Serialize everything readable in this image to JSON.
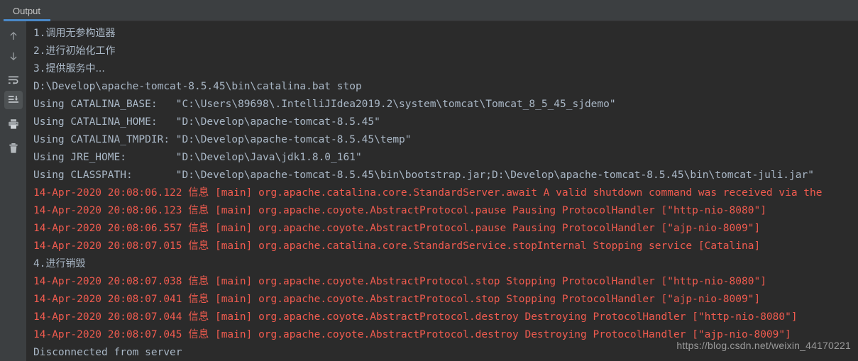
{
  "tabs": [
    {
      "label": "Output",
      "active": true
    }
  ],
  "toolbar": {
    "buttons": [
      {
        "name": "up-arrow-icon",
        "tooltip": "Up",
        "selected": false
      },
      {
        "name": "down-arrow-icon",
        "tooltip": "Down",
        "selected": false
      },
      {
        "name": "soft-wrap-icon",
        "tooltip": "Soft-Wrap",
        "selected": false
      },
      {
        "name": "scroll-to-end-icon",
        "tooltip": "Scroll to End",
        "selected": true
      },
      {
        "name": "print-icon",
        "tooltip": "Print",
        "selected": false
      },
      {
        "name": "trash-icon",
        "tooltip": "Clear All",
        "selected": false
      }
    ]
  },
  "colors": {
    "tab_underline": "#4a88c7",
    "toolbar_bg": "#3c3f41",
    "console_bg": "#2b2b2b",
    "normal_text": "#a9b7c6",
    "error_text": "#f05b4f",
    "selected_btn_bg": "#4e5254"
  },
  "console": {
    "lines": [
      {
        "type": "cn",
        "num": "1.",
        "text": "调用无参构造器"
      },
      {
        "type": "cn",
        "num": "2.",
        "text": "进行初始化工作"
      },
      {
        "type": "cn",
        "num": "3.",
        "text": "提供服务中...",
        "mono_tail": "..."
      },
      {
        "type": "sys",
        "text": "D:\\Develop\\apache-tomcat-8.5.45\\bin\\catalina.bat stop"
      },
      {
        "type": "sys",
        "text": "Using CATALINA_BASE:   \"C:\\Users\\89698\\.IntelliJIdea2019.2\\system\\tomcat\\Tomcat_8_5_45_sjdemo\""
      },
      {
        "type": "sys",
        "text": "Using CATALINA_HOME:   \"D:\\Develop\\apache-tomcat-8.5.45\""
      },
      {
        "type": "sys",
        "text": "Using CATALINA_TMPDIR: \"D:\\Develop\\apache-tomcat-8.5.45\\temp\""
      },
      {
        "type": "sys",
        "text": "Using JRE_HOME:        \"D:\\Develop\\Java\\jdk1.8.0_161\""
      },
      {
        "type": "sys",
        "text": "Using CLASSPATH:       \"D:\\Develop\\apache-tomcat-8.5.45\\bin\\bootstrap.jar;D:\\Develop\\apache-tomcat-8.5.45\\bin\\tomcat-juli.jar\""
      },
      {
        "type": "err",
        "text": "14-Apr-2020 20:08:06.122 信息 [main] org.apache.catalina.core.StandardServer.await A valid shutdown command was received via the"
      },
      {
        "type": "err",
        "text": "14-Apr-2020 20:08:06.123 信息 [main] org.apache.coyote.AbstractProtocol.pause Pausing ProtocolHandler [\"http-nio-8080\"]"
      },
      {
        "type": "err",
        "text": "14-Apr-2020 20:08:06.557 信息 [main] org.apache.coyote.AbstractProtocol.pause Pausing ProtocolHandler [\"ajp-nio-8009\"]"
      },
      {
        "type": "err",
        "text": "14-Apr-2020 20:08:07.015 信息 [main] org.apache.catalina.core.StandardService.stopInternal Stopping service [Catalina]"
      },
      {
        "type": "cn",
        "num": "4.",
        "text": "进行销毁"
      },
      {
        "type": "err",
        "text": "14-Apr-2020 20:08:07.038 信息 [main] org.apache.coyote.AbstractProtocol.stop Stopping ProtocolHandler [\"http-nio-8080\"]"
      },
      {
        "type": "err",
        "text": "14-Apr-2020 20:08:07.041 信息 [main] org.apache.coyote.AbstractProtocol.stop Stopping ProtocolHandler [\"ajp-nio-8009\"]"
      },
      {
        "type": "err",
        "text": "14-Apr-2020 20:08:07.044 信息 [main] org.apache.coyote.AbstractProtocol.destroy Destroying ProtocolHandler [\"http-nio-8080\"]"
      },
      {
        "type": "err",
        "text": "14-Apr-2020 20:08:07.045 信息 [main] org.apache.coyote.AbstractProtocol.destroy Destroying ProtocolHandler [\"ajp-nio-8009\"]"
      },
      {
        "type": "sys",
        "text": "Disconnected from server"
      }
    ]
  },
  "watermark": {
    "text": "https://blog.csdn.net/weixin_44170221"
  }
}
